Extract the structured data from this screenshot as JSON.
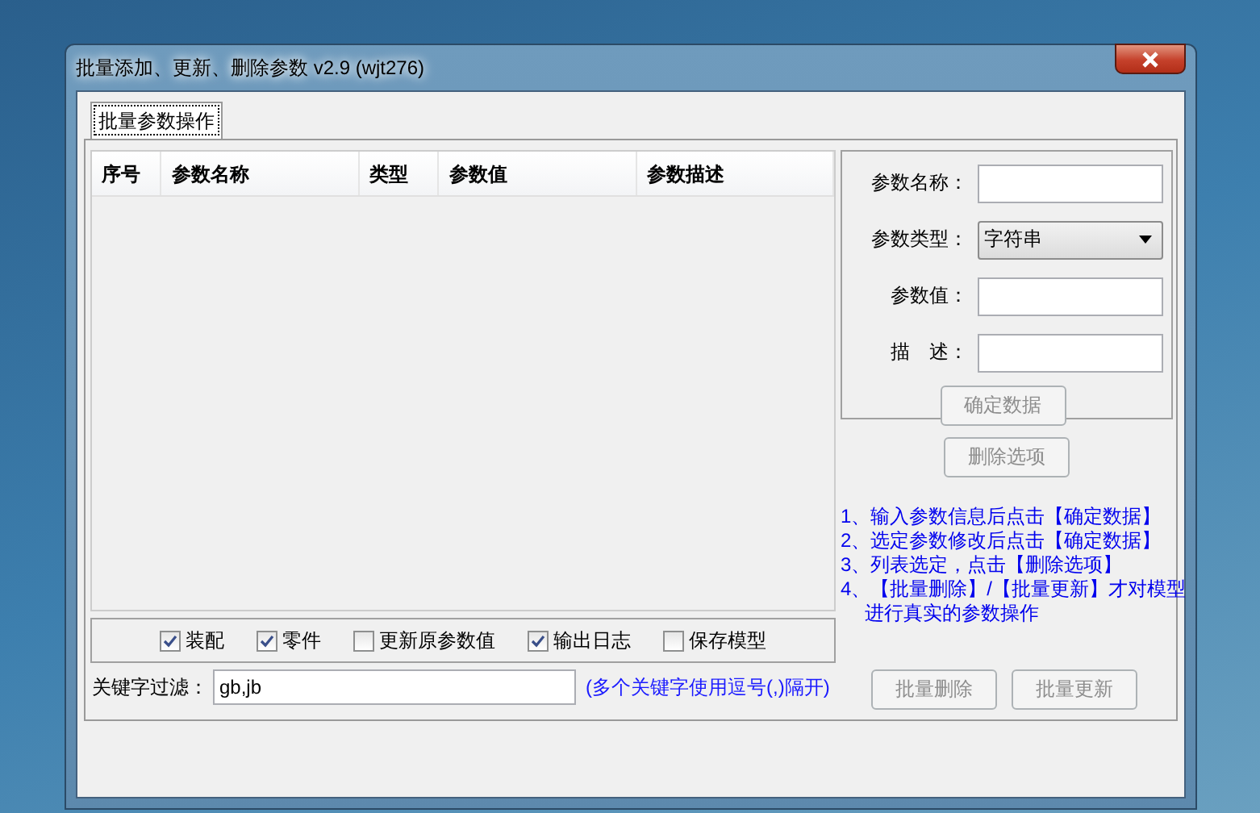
{
  "window": {
    "title": "批量添加、更新、删除参数 v2.9 (wjt276)"
  },
  "tabs": [
    {
      "label": "批量参数操作",
      "selected": true
    }
  ],
  "table": {
    "columns": [
      "序号",
      "参数名称",
      "类型",
      "参数值",
      "参数描述"
    ]
  },
  "form": {
    "fields": [
      {
        "label": "参数名称：",
        "kind": "text"
      },
      {
        "label": "参数类型：",
        "kind": "select",
        "value": "字符串"
      },
      {
        "label": "参数值：",
        "kind": "text"
      },
      {
        "label": "描　述：",
        "kind": "text"
      }
    ],
    "confirm_button": {
      "label": "确定数据",
      "disabled": true
    }
  },
  "delete_button": {
    "label": "删除选项",
    "disabled": true
  },
  "instructions": [
    "1、输入参数信息后点击【确定数据】",
    "2、选定参数修改后点击【确定数据】",
    "3、列表选定，点击【删除选项】",
    "4、【批量删除】/【批量更新】才对模型进行真实的参数操作"
  ],
  "bulk_buttons": [
    {
      "label": "批量删除",
      "disabled": true
    },
    {
      "label": "批量更新",
      "disabled": true
    }
  ],
  "options": [
    {
      "label": "装配",
      "checked": true
    },
    {
      "label": "零件",
      "checked": true
    },
    {
      "label": "更新原参数值",
      "checked": false
    },
    {
      "label": "输出日志",
      "checked": true
    },
    {
      "label": "保存模型",
      "checked": false
    }
  ],
  "filter": {
    "label": "关键字过滤：",
    "value": "gb,jb",
    "hint": "(多个关键字使用逗号(,)隔开)"
  }
}
